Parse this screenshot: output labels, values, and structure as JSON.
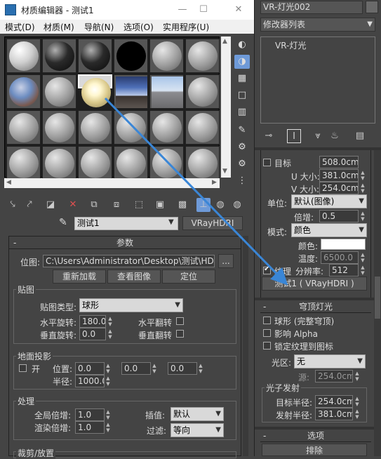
{
  "window": {
    "title": "材质编辑器 - 测试1",
    "min": "—",
    "max": "☐",
    "close": "✕"
  },
  "menu": [
    "模式(D)",
    "材质(M)",
    "导航(N)",
    "选项(O)",
    "实用程序(U)"
  ],
  "material_name": "测试1",
  "material_type": "VRayHDRI",
  "params": {
    "header": "参数",
    "path_label": "位图:",
    "path_value": "C:\\Users\\Administrator\\Desktop\\测试\\HDRI\\HDRI",
    "browse": "...",
    "reload": "重新加载",
    "view_image": "查看图像",
    "locate": "定位",
    "mapping": {
      "title": "贴图",
      "type_label": "贴图类型:",
      "type_value": "球形",
      "h_rot_label": "水平旋转:",
      "h_rot": "180.0",
      "v_rot_label": "垂直旋转:",
      "v_rot": "0.0",
      "h_flip_label": "水平翻转",
      "v_flip_label": "垂直翻转"
    },
    "ground": {
      "title": "地面投影",
      "on_label": "开",
      "pos_label": "位置:",
      "pos": [
        "0.0",
        "0.0",
        "0.0"
      ],
      "radius_label": "半径:",
      "radius": "1000.0"
    },
    "processing": {
      "title": "处理",
      "global_mult_label": "全局倍增:",
      "global_mult": "1.0",
      "render_mult_label": "渲染倍增:",
      "render_mult": "1.0",
      "interp_label": "插值:",
      "interp": "默认",
      "filter_label": "过滤:",
      "filter": "等向"
    },
    "crop_title": "裁剪/放置"
  },
  "right": {
    "object_name": "VR-灯光002",
    "modifier_list": "修改器列表",
    "stack_item": "VR-灯光",
    "target_label": "目标",
    "target_value": "508.0cm",
    "usize_label": "U 大小:",
    "usize": "381.0cm",
    "vsize_label": "V 大小:",
    "vsize": "254.0cm",
    "unit_label": "单位:",
    "unit": "默认(图像)",
    "mult_label": "倍增:",
    "mult": "0.5",
    "mode_label": "模式:",
    "mode": "颜色",
    "color_label": "颜色:",
    "temp_label": "温度:",
    "temp": "6500.0",
    "texture_label": "纹理",
    "res_label": "分辨率:",
    "res": "512",
    "texture_button": "测试1 ( VRayHDRI )",
    "dome_header": "穹顶灯光",
    "dome_sphere": "球形 (完整穹顶)",
    "affect_alpha": "影响 Alpha",
    "lock_texture": "锁定纹理到图标",
    "area_label": "光区:",
    "area": "无",
    "source_label": "源:",
    "source": "254.0cm",
    "photon_title": "光子发射",
    "target_radius_label": "目标半径:",
    "target_radius": "254.0cm",
    "emit_radius_label": "发射半径:",
    "emit_radius": "381.0cm",
    "options_header": "选项",
    "exclude": "排除"
  },
  "colors": {
    "accent": "#6e9ad8",
    "arrow": "#3a86d6"
  }
}
